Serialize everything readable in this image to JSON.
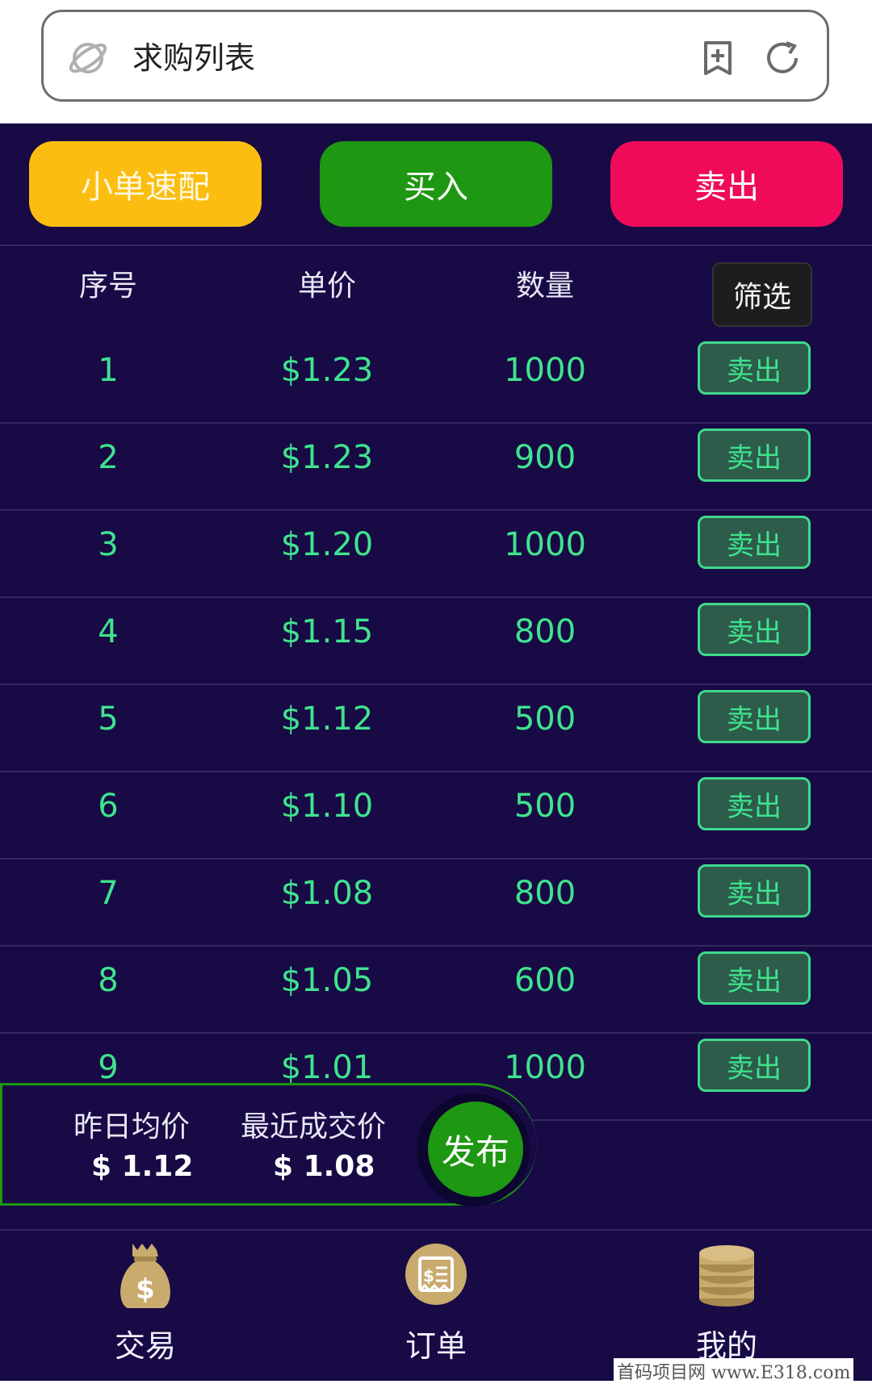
{
  "address_bar": {
    "title": "求购列表"
  },
  "actions": {
    "quick_match": "小单速配",
    "buy": "买入",
    "sell": "卖出"
  },
  "table": {
    "headers": [
      "序号",
      "单价",
      "数量"
    ],
    "filter_label": "筛选",
    "rows": [
      {
        "index": "1",
        "price": "$1.23",
        "qty": "1000",
        "action": "卖出"
      },
      {
        "index": "2",
        "price": "$1.23",
        "qty": "900",
        "action": "卖出"
      },
      {
        "index": "3",
        "price": "$1.20",
        "qty": "1000",
        "action": "卖出"
      },
      {
        "index": "4",
        "price": "$1.15",
        "qty": "800",
        "action": "卖出"
      },
      {
        "index": "5",
        "price": "$1.12",
        "qty": "500",
        "action": "卖出"
      },
      {
        "index": "6",
        "price": "$1.10",
        "qty": "500",
        "action": "卖出"
      },
      {
        "index": "7",
        "price": "$1.08",
        "qty": "800",
        "action": "卖出"
      },
      {
        "index": "8",
        "price": "$1.05",
        "qty": "600",
        "action": "卖出"
      },
      {
        "index": "9",
        "price": "$1.01",
        "qty": "1000",
        "action": "卖出"
      }
    ]
  },
  "stats": {
    "yesterday_avg_label": "昨日均价",
    "yesterday_avg_value": "$ 1.12",
    "last_trade_label": "最近成交价",
    "last_trade_value": "$ 1.08",
    "publish_label": "发布"
  },
  "nav": {
    "items": [
      {
        "label": "交易",
        "icon": "money-bag-icon"
      },
      {
        "label": "订单",
        "icon": "receipt-icon"
      },
      {
        "label": "我的",
        "icon": "coin-stack-icon"
      }
    ]
  },
  "watermark": "首码项目网 www.E318.com",
  "colors": {
    "background": "#170a45",
    "quick_match": "#fbbd0f",
    "buy": "#1e9712",
    "sell": "#ef0b5a",
    "row_text": "#3fe38d",
    "icon_gold": "#c9ab6e"
  }
}
